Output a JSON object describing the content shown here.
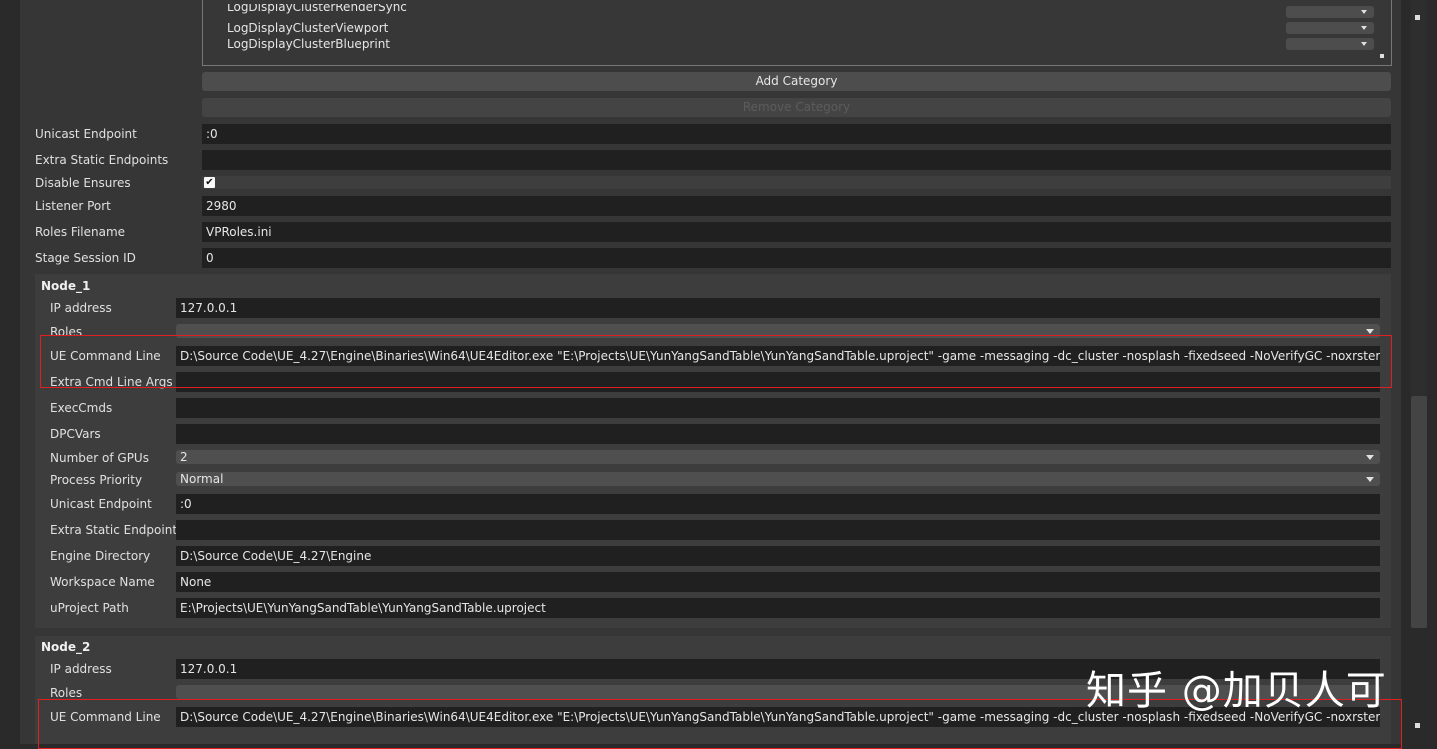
{
  "categories": {
    "items": [
      "LogDisplayClusterRenderSync",
      "LogDisplayClusterViewport",
      "LogDisplayClusterBlueprint"
    ],
    "add_label": "Add Category",
    "remove_label": "Remove Category"
  },
  "settings": {
    "unicast_endpoint": {
      "label": "Unicast Endpoint",
      "value": ":0"
    },
    "extra_static_endpoints": {
      "label": "Extra Static Endpoints",
      "value": ""
    },
    "disable_ensures": {
      "label": "Disable Ensures",
      "checked": true,
      "check_glyph": "✔"
    },
    "listener_port": {
      "label": "Listener Port",
      "value": "2980"
    },
    "roles_filename": {
      "label": "Roles Filename",
      "value": "VPRoles.ini"
    },
    "stage_session_id": {
      "label": "Stage Session ID",
      "value": "0"
    }
  },
  "node1": {
    "title": "Node_1",
    "ip_label": "IP address",
    "ip": "127.0.0.1",
    "roles_label": "Roles",
    "roles": "",
    "cmd_label": "UE Command Line",
    "cmd": "D:\\Source Code\\UE_4.27\\Engine\\Binaries\\Win64\\UE4Editor.exe \"E:\\Projects\\UE\\YunYangSandTable\\YunYangSandTable.uproject\"  -game -messaging -dc_cluster -nosplash -fixedseed -NoVerifyGC -noxrstereo -xrtrackingonly",
    "extra_label": "Extra Cmd Line Args",
    "extra": "",
    "exec_label": "ExecCmds",
    "exec": "",
    "dpc_label": "DPCVars",
    "dpc": "",
    "gpus_label": "Number of GPUs",
    "gpus": "2",
    "priority_label": "Process Priority",
    "priority": "Normal",
    "unicast_label": "Unicast Endpoint",
    "unicast": ":0",
    "static_label": "Extra Static Endpoints",
    "static": "",
    "engine_label": "Engine Directory",
    "engine": "D:\\Source Code\\UE_4.27\\Engine",
    "workspace_label": "Workspace Name",
    "workspace": "None",
    "project_label": "uProject Path",
    "project": "E:\\Projects\\UE\\YunYangSandTable\\YunYangSandTable.uproject"
  },
  "node2": {
    "title": "Node_2",
    "ip_label": "IP address",
    "ip": "127.0.0.1",
    "roles_label": "Roles",
    "roles": "",
    "cmd_label": "UE Command Line",
    "cmd": "D:\\Source Code\\UE_4.27\\Engine\\Binaries\\Win64\\UE4Editor.exe \"E:\\Projects\\UE\\YunYangSandTable\\YunYangSandTable.uproject\"  -game -messaging -dc_cluster -nosplash -fixedseed -NoVerifyGC -noxrstereo -xrtrackingonly"
  },
  "watermark": "知乎 @加贝人可",
  "colors": {
    "highlight": "#e02020",
    "field_bg": "#202020",
    "panel_bg": "#363636"
  }
}
